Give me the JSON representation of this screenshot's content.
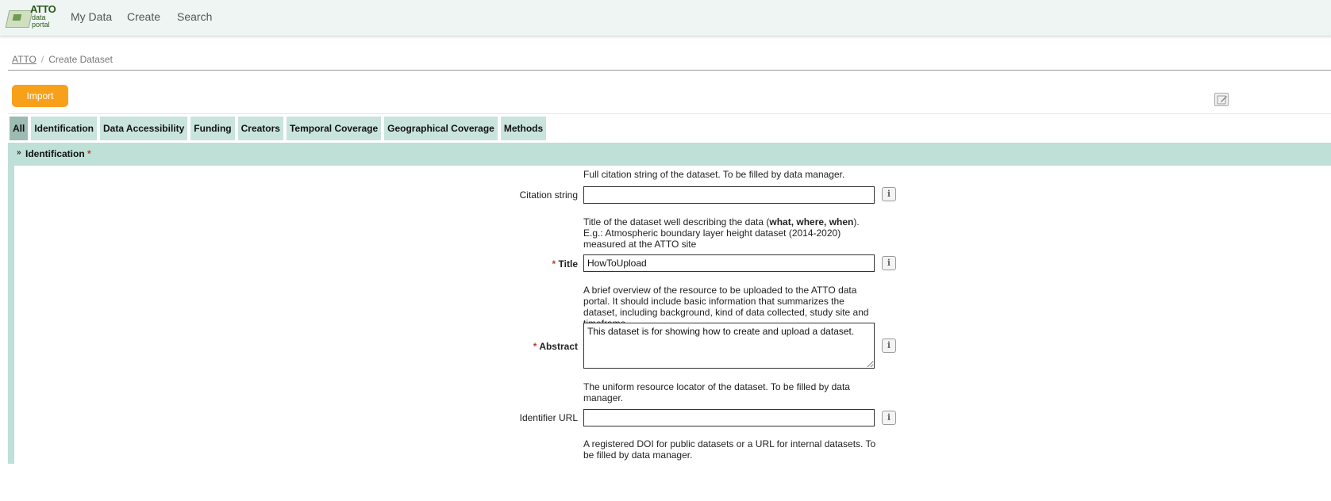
{
  "logo": {
    "name": "ATTO",
    "line1": "data",
    "line2": "portal"
  },
  "nav": {
    "my_data": "My Data",
    "create": "Create",
    "search": "Search"
  },
  "breadcrumb": {
    "root": "ATTO",
    "separator": "/",
    "current": "Create Dataset"
  },
  "toolbar": {
    "import_label": "Import"
  },
  "tabs": [
    {
      "label": "All",
      "active": true
    },
    {
      "label": "Identification"
    },
    {
      "label": "Data Accessibility"
    },
    {
      "label": "Funding"
    },
    {
      "label": "Creators"
    },
    {
      "label": "Temporal Coverage"
    },
    {
      "label": "Geographical Coverage"
    },
    {
      "label": "Methods"
    }
  ],
  "section": {
    "title": "Identification",
    "required_mark": "*"
  },
  "fields": {
    "citation": {
      "help": "Full citation string of the dataset. To be filled by data manager.",
      "label": "Citation string",
      "value": ""
    },
    "title": {
      "help_pre": "Title of the dataset well describing the data (",
      "help_bold": "what, where, when",
      "help_post": "). E.g.: Atmospheric boundary layer height dataset (2014-2020) measured at the ATTO site",
      "required_mark": "*",
      "label": "Title",
      "value": "HowToUpload"
    },
    "abstract": {
      "help": "A brief overview of the resource to be uploaded to the ATTO data portal. It should include basic information that summarizes the dataset, including background, kind of data collected, study site and timeframe.",
      "required_mark": "*",
      "label": "Abstract",
      "value": "This dataset is for showing how to create and upload a dataset."
    },
    "identifier_url": {
      "help": "The uniform resource locator of the dataset. To be filled by data manager.",
      "label": "Identifier URL",
      "value": ""
    },
    "doi_help": "A registered DOI for public datasets or a URL for internal datasets. To be filled by data manager."
  },
  "info_glyph": "i",
  "colors": {
    "accent": "#f7a11a",
    "section": "#bfe0d6",
    "tab": "#c9e4dd",
    "tab_active": "#9cbcb3",
    "required": "#c0392b"
  }
}
